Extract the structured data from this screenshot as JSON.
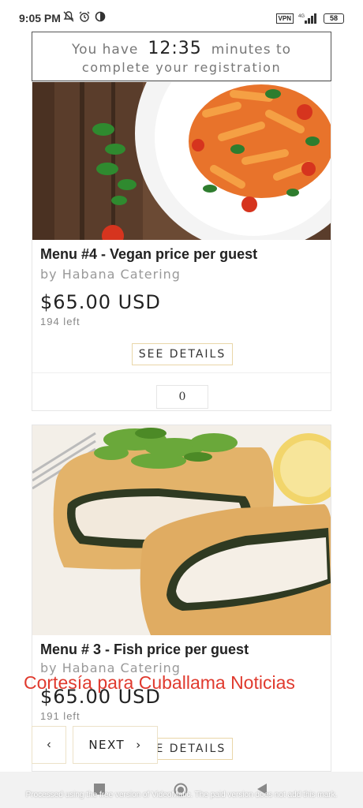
{
  "status_bar": {
    "time": "9:05 PM",
    "vpn": "VPN",
    "network": "4G",
    "battery": "58"
  },
  "timer": {
    "prefix": "You have",
    "value": "12:35",
    "suffix": "minutes to",
    "line2": "complete your registration"
  },
  "menus": [
    {
      "title": "Menu #4 - Vegan price per guest",
      "vendor": "by Habana Catering",
      "price": "$65.00 USD",
      "stock": "194 left",
      "details_label": "SEE DETAILS",
      "quantity": "0",
      "image": "pasta-dish"
    },
    {
      "title": "Menu # 3 - Fish price per guest",
      "vendor": "by Habana Catering",
      "price": "$65.00 USD",
      "stock": "191 left",
      "details_label": "SEE DETAILS",
      "image": "fish-wellington"
    }
  ],
  "pager": {
    "prev_icon": "chevron-left-icon",
    "prev_glyph": "‹",
    "next_label": "NEXT",
    "next_glyph": "›"
  },
  "watermark": "Cortesía para Cuballama Noticias",
  "nav_note": "Processed using the free version of VideoMatic. The paid version does not add this mark.",
  "colors": {
    "accent_border": "#e9d6a8",
    "watermark_red": "#e03a2e"
  }
}
